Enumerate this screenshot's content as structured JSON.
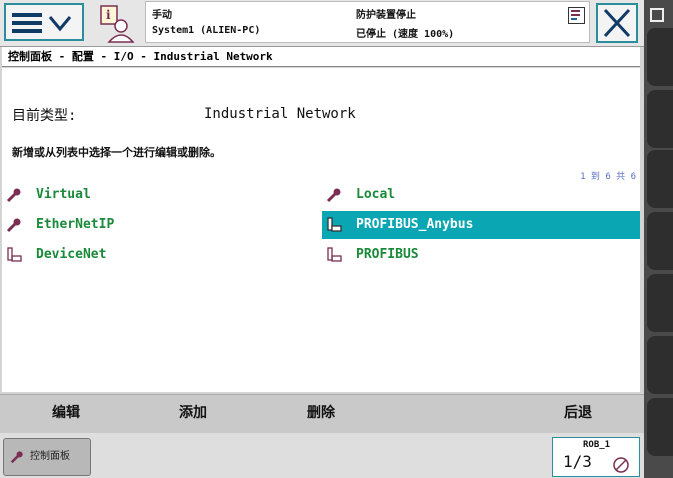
{
  "header": {
    "menu_icon": "hamburger-chevron-icon",
    "user_icon": "operator-info-icon",
    "status": {
      "mode": "手动",
      "system": "System1 (ALIEN-PC)",
      "safety": "防护装置停止",
      "state": "已停止 (速度 100%)"
    },
    "close_icon": "close-x-icon"
  },
  "breadcrumb": "控制面板 - 配置 - I/O - Industrial Network",
  "main": {
    "type_label": "目前类型:",
    "type_value": "Industrial Network",
    "instruction": "新增或从列表中选择一个进行编辑或删除。",
    "count": "1 到 6 共 6",
    "items": [
      {
        "label": "Virtual",
        "icon": "wrench-icon",
        "selected": false
      },
      {
        "label": "Local",
        "icon": "wrench-icon",
        "selected": false
      },
      {
        "label": "EtherNetIP",
        "icon": "wrench-icon",
        "selected": false
      },
      {
        "label": "PROFIBUS_Anybus",
        "icon": "network-device-icon",
        "selected": true
      },
      {
        "label": "DeviceNet",
        "icon": "network-device-icon",
        "selected": false
      },
      {
        "label": "PROFIBUS",
        "icon": "network-device-icon",
        "selected": false
      }
    ]
  },
  "commands": {
    "edit": "编辑",
    "add": "添加",
    "delete": "删除",
    "back": "后退"
  },
  "taskbar": {
    "control_panel": "控制面板"
  },
  "robot": {
    "name": "ROB_1",
    "fraction": "1/3"
  },
  "colors": {
    "accent": "#2b8e9c",
    "selected": "#0aa6b3",
    "item_text": "#1a8a3a"
  }
}
